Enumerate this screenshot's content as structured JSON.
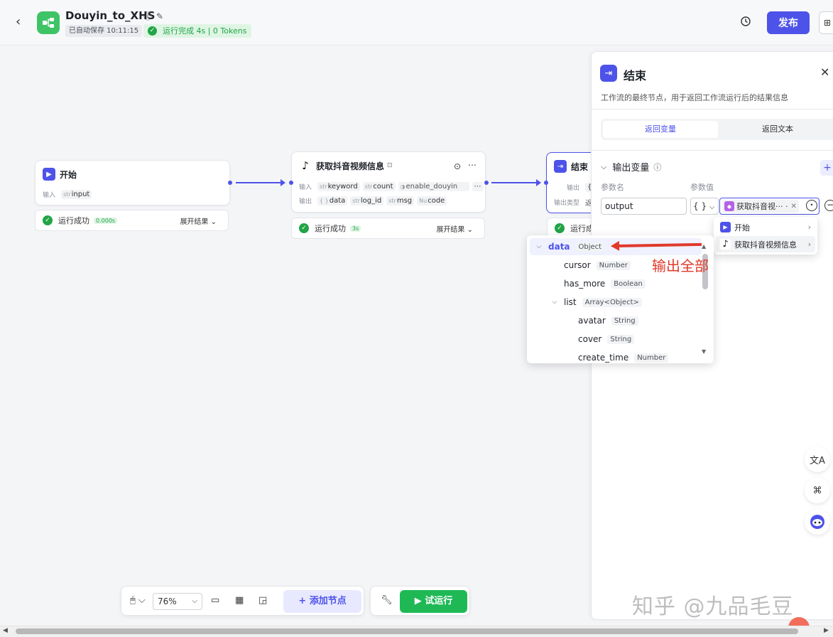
{
  "header": {
    "back": "‹",
    "title": "Douyin_to_XHS",
    "autosave": "已自动保存 10:11:15",
    "run_status": "运行完成 4s | 0 Tokens",
    "publish": "发布"
  },
  "nodes": {
    "start": {
      "title": "开始",
      "input_label": "输入",
      "input_type": "str",
      "input_name": "input",
      "status": "运行成功",
      "time": "0.000s",
      "expand": "展开结果 ⌄"
    },
    "douyin": {
      "title": "获取抖音视频信息",
      "input_label": "输入",
      "output_label": "输出",
      "inputs": [
        {
          "type": "str",
          "name": "keyword"
        },
        {
          "type": "str",
          "name": "count"
        },
        {
          "type": "",
          "name": "enable_douyin"
        }
      ],
      "outputs": [
        {
          "type": "{ }",
          "name": "data"
        },
        {
          "type": "str",
          "name": "log_id"
        },
        {
          "type": "str",
          "name": "msg"
        },
        {
          "type": "Nu",
          "name": "code"
        }
      ],
      "status": "运行成功",
      "time": "3s",
      "expand": "展开结果 ⌄"
    },
    "end": {
      "title": "结束",
      "row1_label": "输出",
      "row1_value": "{",
      "row2_label": "输出类型",
      "row2_value": "返",
      "status": "运行成"
    }
  },
  "panel": {
    "title": "结束",
    "description": "工作流的最终节点，用于返回工作流运行后的结果信息",
    "tabs": [
      "返回变量",
      "返回文本"
    ],
    "section": "输出变量",
    "col_name": "参数名",
    "col_value": "参数值",
    "param_name": "output",
    "param_type": "{ }",
    "value_chip": "获取抖音视··· ·"
  },
  "node_picker": [
    {
      "label": "开始"
    },
    {
      "label": "获取抖音视频信息"
    }
  ],
  "var_tree": [
    {
      "key": "data",
      "type": "Object",
      "depth": 0,
      "expanded": true,
      "selected": true
    },
    {
      "key": "cursor",
      "type": "Number",
      "depth": 1
    },
    {
      "key": "has_more",
      "type": "Boolean",
      "depth": 1
    },
    {
      "key": "list",
      "type": "Array<Object>",
      "depth": 1,
      "expanded": true
    },
    {
      "key": "avatar",
      "type": "String",
      "depth": 2
    },
    {
      "key": "cover",
      "type": "String",
      "depth": 2
    },
    {
      "key": "create_time",
      "type": "Number",
      "depth": 2
    }
  ],
  "annotation": "输出全部",
  "toolbar": {
    "zoom": "76%",
    "add_node": "添加节点",
    "trial_run": "试运行"
  },
  "watermark": "知乎 @九品毛豆",
  "colors": {
    "primary": "#4d53e8",
    "success": "#22a447",
    "run_button": "#1eb955",
    "annotation": "#e03a2b"
  }
}
